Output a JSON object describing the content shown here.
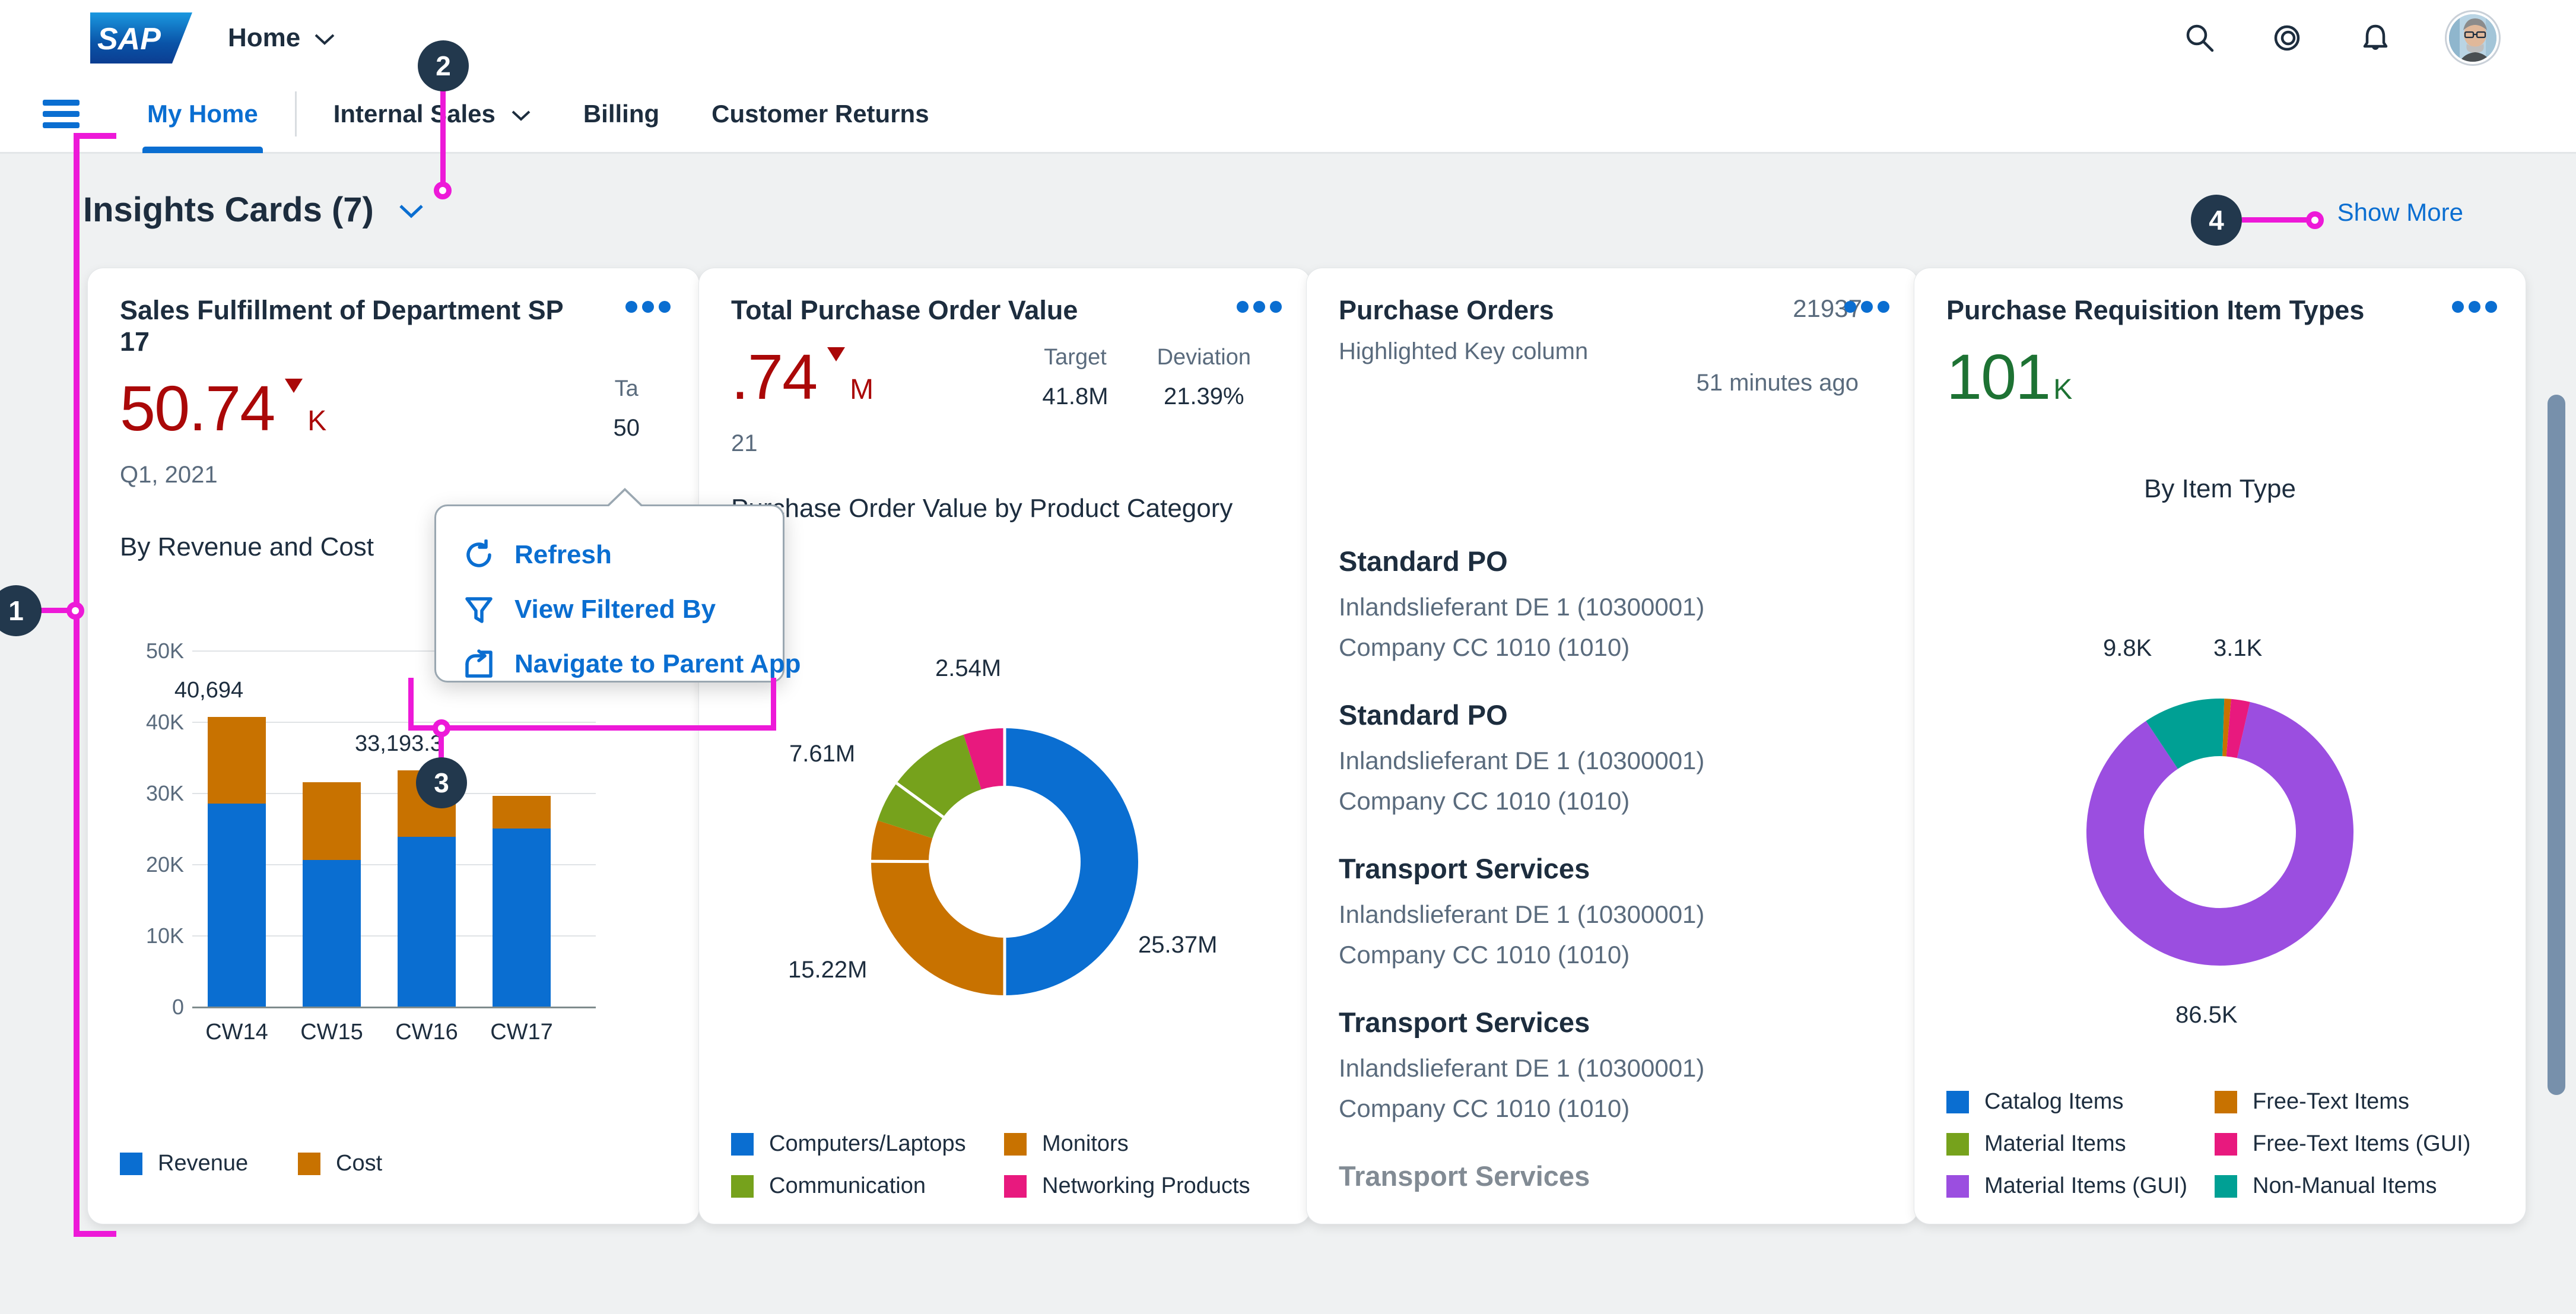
{
  "shellbar": {
    "logo_alt": "SAP",
    "home_label": "Home",
    "icons": [
      "search-icon",
      "target-icon",
      "bell-icon",
      "avatar"
    ]
  },
  "navbar": {
    "menu_icon": "hamburger-menu-icon",
    "tabs": [
      {
        "label": "My Home",
        "active": true,
        "has_chevron": false
      },
      {
        "label": "Internal Sales",
        "active": false,
        "has_chevron": true
      },
      {
        "label": "Billing",
        "active": false,
        "has_chevron": false
      },
      {
        "label": "Customer Returns",
        "active": false,
        "has_chevron": false
      }
    ]
  },
  "section": {
    "title": "Insights Cards (7)",
    "collapse_chevron": "chevron-down-icon",
    "show_more": "Show More"
  },
  "popover": {
    "items": [
      {
        "label": "Refresh",
        "icon": "refresh-icon"
      },
      {
        "label": "View Filtered By",
        "icon": "filter-icon"
      },
      {
        "label": "Navigate to Parent App",
        "icon": "navigate-arrow-icon"
      }
    ]
  },
  "annotations": [
    {
      "number": "1",
      "target": "card-sales-fulfillment"
    },
    {
      "number": "2",
      "target": "card-overflow-menu-button"
    },
    {
      "number": "3",
      "target": "card-actions-popover"
    },
    {
      "number": "4",
      "target": "show-more-link"
    }
  ],
  "cards": [
    {
      "id": "sales-fulfillment",
      "title": "Sales Fulfillment of Department SP 17",
      "kpi_value": "50.74",
      "kpi_unit": "K",
      "kpi_trend": "down",
      "kpi_color": "#aa0808",
      "period": "Q1, 2021",
      "side_metrics": [
        {
          "label": "Ta",
          "value": "50",
          "truncated": true
        }
      ],
      "by_label": "By Revenue and Cost"
    },
    {
      "id": "total-purchase-order-value",
      "title": "Total Purchase Order Value",
      "kpi_value": ".74",
      "kpi_unit": "M",
      "kpi_trend": "down",
      "kpi_color": "#aa0808",
      "period": "21",
      "side_metrics": [
        {
          "label": "Target",
          "value": "41.8M"
        },
        {
          "label": "Deviation",
          "value": "21.39%"
        }
      ],
      "by_label": "Purchase Order Value by Product Category"
    },
    {
      "id": "purchase-orders",
      "title": "Purchase Orders",
      "count": "21937",
      "subtitle": "Highlighted Key column",
      "timestamp": "51 minutes ago",
      "items": [
        {
          "name": "Standard PO",
          "supplier": "Inlandslieferant DE 1 (10300001)",
          "company": "Company CC 1010 (1010)"
        },
        {
          "name": "Standard PO",
          "supplier": "Inlandslieferant DE 1 (10300001)",
          "company": "Company CC 1010 (1010)"
        },
        {
          "name": "Transport Services",
          "supplier": "Inlandslieferant DE 1 (10300001)",
          "company": "Company CC 1010 (1010)"
        },
        {
          "name": "Transport Services",
          "supplier": "Inlandslieferant DE 1 (10300001)",
          "company": "Company CC 1010 (1010)"
        },
        {
          "name": "Transport Services",
          "supplier": "",
          "company": ""
        }
      ]
    },
    {
      "id": "purchase-requisition-item-types",
      "title": "Purchase Requisition Item Types",
      "kpi_value": "101",
      "kpi_unit": "K",
      "kpi_color": "#1d7233",
      "by_label": "By Item Type"
    }
  ],
  "chart_data": [
    {
      "type": "bar",
      "card": "Sales Fulfillment of Department SP 17",
      "title": "By Revenue and Cost",
      "stacked": true,
      "categories": [
        "CW14",
        "CW15",
        "CW16",
        "CW17"
      ],
      "series": [
        {
          "name": "Revenue",
          "color": "#0a6ed1",
          "values": [
            28500,
            20600,
            23800,
            25000
          ]
        },
        {
          "name": "Cost",
          "color": "#c87200",
          "values": [
            12194,
            10900,
            9393,
            4600
          ]
        }
      ],
      "totals": [
        40694,
        31500,
        33193.3,
        29600
      ],
      "data_labels": [
        {
          "category": "CW14",
          "text": "40,694"
        },
        {
          "category": "CW16",
          "text": "33,193.3"
        }
      ],
      "ylabel": "",
      "xlabel": "",
      "ylim": [
        0,
        50000
      ],
      "yticks": [
        "0",
        "10K",
        "20K",
        "30K",
        "40K",
        "50K"
      ],
      "grid": true,
      "legend_position": "bottom"
    },
    {
      "type": "pie",
      "variant": "donut",
      "card": "Total Purchase Order Value",
      "title": "Purchase Order Value by Product Category",
      "labels": [
        "Computers/Laptops",
        "Monitors",
        "Communication",
        "Networking Products"
      ],
      "values": [
        25.37,
        15.22,
        7.61,
        2.54
      ],
      "value_labels": [
        "25.37M",
        "15.22M",
        "7.61M",
        "2.54M"
      ],
      "colors": [
        "#0a6ed1",
        "#c87200",
        "#76a21c",
        "#e8197e"
      ],
      "unit": "M",
      "legend_position": "bottom"
    },
    {
      "type": "pie",
      "variant": "donut",
      "card": "Purchase Requisition Item Types",
      "title": "By Item Type",
      "labels": [
        "Catalog Items",
        "Free-Text Items",
        "Material Items",
        "Free-Text Items (GUI)",
        "Material Items (GUI)",
        "Non-Manual Items"
      ],
      "values": [
        0,
        0.6,
        0,
        3.1,
        86.5,
        9.8
      ],
      "value_labels": [
        "86.5K",
        "9.8K",
        "3.1K"
      ],
      "colors": [
        "#0a6ed1",
        "#c87200",
        "#76a21c",
        "#e8197e",
        "#9b4ee0",
        "#00a094"
      ],
      "unit": "K",
      "legend_position": "bottom"
    }
  ]
}
